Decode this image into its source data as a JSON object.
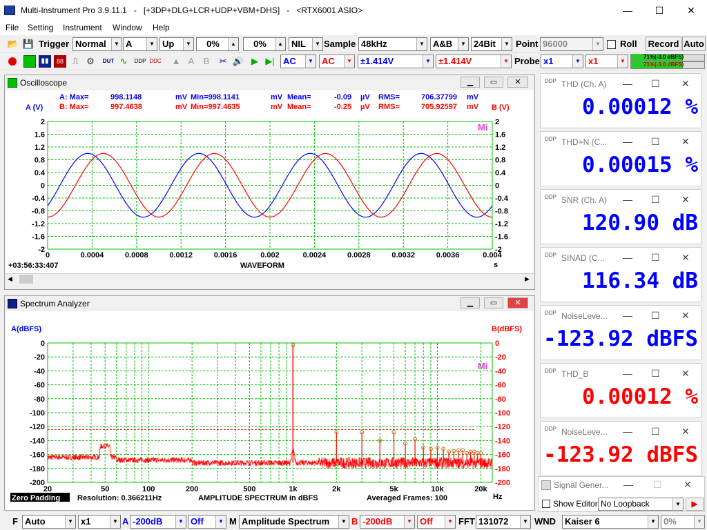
{
  "window": {
    "title": "Multi-Instrument Pro 3.9.11.1   -   [+3DP+DLG+LCR+UDP+VBM+DHS]   -   <RTX6001 ASIO>",
    "min": "—",
    "max": "☐",
    "close": "✕"
  },
  "menu": [
    "File",
    "Setting",
    "Instrument",
    "Window",
    "Help"
  ],
  "toolbar1": {
    "trigger_label": "Trigger",
    "trigger_mode": "Normal",
    "trigger_channel": "A",
    "trigger_edge": "Up",
    "level1": "0%",
    "level2": "0%",
    "nil": "NIL",
    "sample_label": "Sample",
    "sample_rate": "48kHz",
    "channels": "A&B",
    "bits": "24Bit",
    "point_label": "Point",
    "points": "96000",
    "roll_label": "Roll",
    "record_label": "Record",
    "auto_label": "Auto"
  },
  "toolbar2": {
    "coupling_a": "AC",
    "coupling_b": "AC",
    "range_a": "±1.414V",
    "range_b": "±1.414V",
    "probe_label": "Probe",
    "probe_a": "x1",
    "probe_b": "x1",
    "level_a_text": "71%(-3.0 dBFS)",
    "level_b_text": "71%(-3.0 dBFS)",
    "level_a_pct": 71,
    "level_b_pct": 71
  },
  "oscilloscope": {
    "title": "Oscilloscope",
    "stats_a": {
      "label": "A: Max=",
      "max": "998.1148",
      "u1": "mV",
      "min_label": "Min=",
      "min": "-998.1141",
      "u2": "mV",
      "mean_label": "Mean=",
      "mean": "-0.09",
      "u3": "µV",
      "rms_label": "RMS=",
      "rms": "706.37799",
      "u4": "mV"
    },
    "stats_b": {
      "label": "B: Max=",
      "max": "997.4638",
      "u1": "mV",
      "min_label": "Min=",
      "min": "-997.4635",
      "u2": "mV",
      "mean_label": "Mean=",
      "mean": "-0.25",
      "u3": "µV",
      "rms_label": "RMS=",
      "rms": "705.92597",
      "u4": "mV"
    },
    "left_axis": "A (V)",
    "right_axis": "B (V)",
    "xlabel": "WAVEFORM",
    "xunit": "s",
    "timestamp": "+03:56:33:407",
    "mi": "Mi"
  },
  "spectrum": {
    "title": "Spectrum Analyzer",
    "left_axis": "A(dBFS)",
    "right_axis": "B(dBFS)",
    "xunit": "Hz",
    "zero_padding": "Zero Padding",
    "resolution": "Resolution: 0.366211Hz",
    "xlabel": "AMPLITUDE  SPECTRUM in dBFS",
    "averaged": "Averaged Frames: 100",
    "mi": "Mi"
  },
  "meters": [
    {
      "title": "THD (Ch. A)",
      "value": "0.00012  %",
      "color": "#0000ff"
    },
    {
      "title": "THD+N (C...",
      "value": "0.00015  %",
      "color": "#0000ff"
    },
    {
      "title": "SNR (Ch. A)",
      "value": "120.90  dB",
      "color": "#0000ff"
    },
    {
      "title": "SINAD (C...",
      "value": "116.34  dB",
      "color": "#0000ff"
    },
    {
      "title": "NoiseLeve...",
      "value": "-123.92  dBFS",
      "color": "#0000ff"
    },
    {
      "title": "THD_B",
      "value": "0.00012  %",
      "color": "#ff0000"
    },
    {
      "title": "NoiseLeve...",
      "value": "-123.92  dBFS",
      "color": "#ff0000"
    }
  ],
  "siggen": {
    "title": "Signal Gener...",
    "show_editor": "Show Editor",
    "loopback": "No Loopback"
  },
  "bottombar": {
    "f": "F",
    "mode": "Auto",
    "mult": "x1",
    "a": "A",
    "a_level": "-200dB",
    "a_off": "Off",
    "m": "M",
    "func": "Amplitude Spectrum",
    "b": "B",
    "b_level": "-200dB",
    "b_off": "Off",
    "fft_label": "FFT",
    "fft_size": "131072",
    "wnd_label": "WND",
    "window": "Kaiser 6",
    "overlap": "0%"
  },
  "chart_data": [
    {
      "type": "line",
      "title": "WAVEFORM",
      "xlabel": "s",
      "ylabel": "A (V)",
      "xlim": [
        0,
        0.004
      ],
      "ylim": [
        -2,
        2
      ],
      "xticks": [
        "0",
        "0.0004",
        "0.0008",
        "0.0012",
        "0.0016",
        "0.002",
        "0.0024",
        "0.0028",
        "0.0032",
        "0.0036",
        "0.004"
      ],
      "yticks": [
        "2",
        "1.6",
        "1.2",
        "0.8",
        "0.4",
        "0",
        "-0.4",
        "-0.8",
        "-1.2",
        "-1.6",
        "-2"
      ],
      "series": [
        {
          "name": "A",
          "color": "#0000ff",
          "amplitude": 0.998,
          "frequency_hz": 1000,
          "phase_deg": -40
        },
        {
          "name": "B",
          "color": "#ff0000",
          "amplitude": 0.997,
          "frequency_hz": 1000,
          "phase_deg": -90
        }
      ],
      "grid": true
    },
    {
      "type": "line",
      "title": "AMPLITUDE  SPECTRUM in dBFS",
      "xscale": "log",
      "xlim": [
        20,
        24000
      ],
      "ylim": [
        -200,
        0
      ],
      "xticks": [
        "20",
        "50",
        "100",
        "200",
        "500",
        "1k",
        "2k",
        "5k",
        "10k",
        "20k"
      ],
      "yticks": [
        "0",
        "-20",
        "-40",
        "-60",
        "-80",
        "-100",
        "-120",
        "-140",
        "-160",
        "-180",
        "-200"
      ],
      "threshold_db": -124,
      "fundamental": {
        "freq": 1000,
        "db": -3
      },
      "harmonics": [
        {
          "freq": 2000,
          "db": -128
        },
        {
          "freq": 3000,
          "db": -128
        },
        {
          "freq": 4000,
          "db": -140
        },
        {
          "freq": 5000,
          "db": -128
        },
        {
          "freq": 6000,
          "db": -144
        },
        {
          "freq": 7000,
          "db": -138
        },
        {
          "freq": 8000,
          "db": -150
        },
        {
          "freq": 9000,
          "db": -152
        },
        {
          "freq": 10000,
          "db": -150
        },
        {
          "freq": 11000,
          "db": -152
        },
        {
          "freq": 12000,
          "db": -156
        },
        {
          "freq": 13000,
          "db": -155
        },
        {
          "freq": 14000,
          "db": -154
        },
        {
          "freq": 15000,
          "db": -154
        },
        {
          "freq": 16000,
          "db": -158
        },
        {
          "freq": 17000,
          "db": -156
        },
        {
          "freq": 18000,
          "db": -156
        },
        {
          "freq": 19000,
          "db": -158
        },
        {
          "freq": 20000,
          "db": -158
        }
      ],
      "noise_floor_db": -172,
      "grid": true
    }
  ]
}
